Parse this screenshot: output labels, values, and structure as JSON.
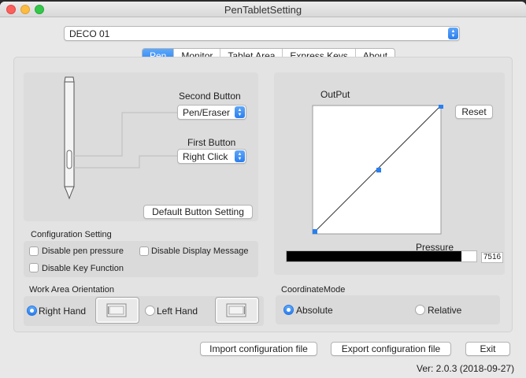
{
  "window": {
    "title": "PenTabletSetting"
  },
  "device": {
    "selected": "DECO 01"
  },
  "tabs": [
    {
      "label": "Pen",
      "active": true
    },
    {
      "label": "Monitor"
    },
    {
      "label": "Tablet Area"
    },
    {
      "label": "Express Keys"
    },
    {
      "label": "About"
    }
  ],
  "pen": {
    "second_button_label": "Second Button",
    "second_button_value": "Pen/Eraser",
    "first_button_label": "First Button",
    "first_button_value": "Right Click",
    "default_button": "Default  Button Setting"
  },
  "output": {
    "label": "OutPut",
    "reset": "Reset",
    "pressure_label": "Pressure",
    "pressure_value": "7516",
    "pressure_level": 0.92
  },
  "config": {
    "title": "Configuration Setting",
    "disable_pen_pressure": "Disable pen pressure",
    "disable_display_message": "Disable Display Message",
    "disable_key_function": "Disable Key Function"
  },
  "orientation": {
    "title": "Work Area Orientation",
    "right_hand": "Right Hand",
    "left_hand": "Left Hand",
    "selected": "Right Hand"
  },
  "coordinate": {
    "title": "CoordinateMode",
    "absolute": "Absolute",
    "relative": "Relative",
    "selected": "Absolute"
  },
  "footer": {
    "import": "Import configuration file",
    "export": "Export configuration file",
    "exit": "Exit",
    "version": "Ver: 2.0.3 (2018-09-27)"
  },
  "colors": {
    "accent": "#2a7ff0",
    "pressure_bar": "#000000"
  }
}
